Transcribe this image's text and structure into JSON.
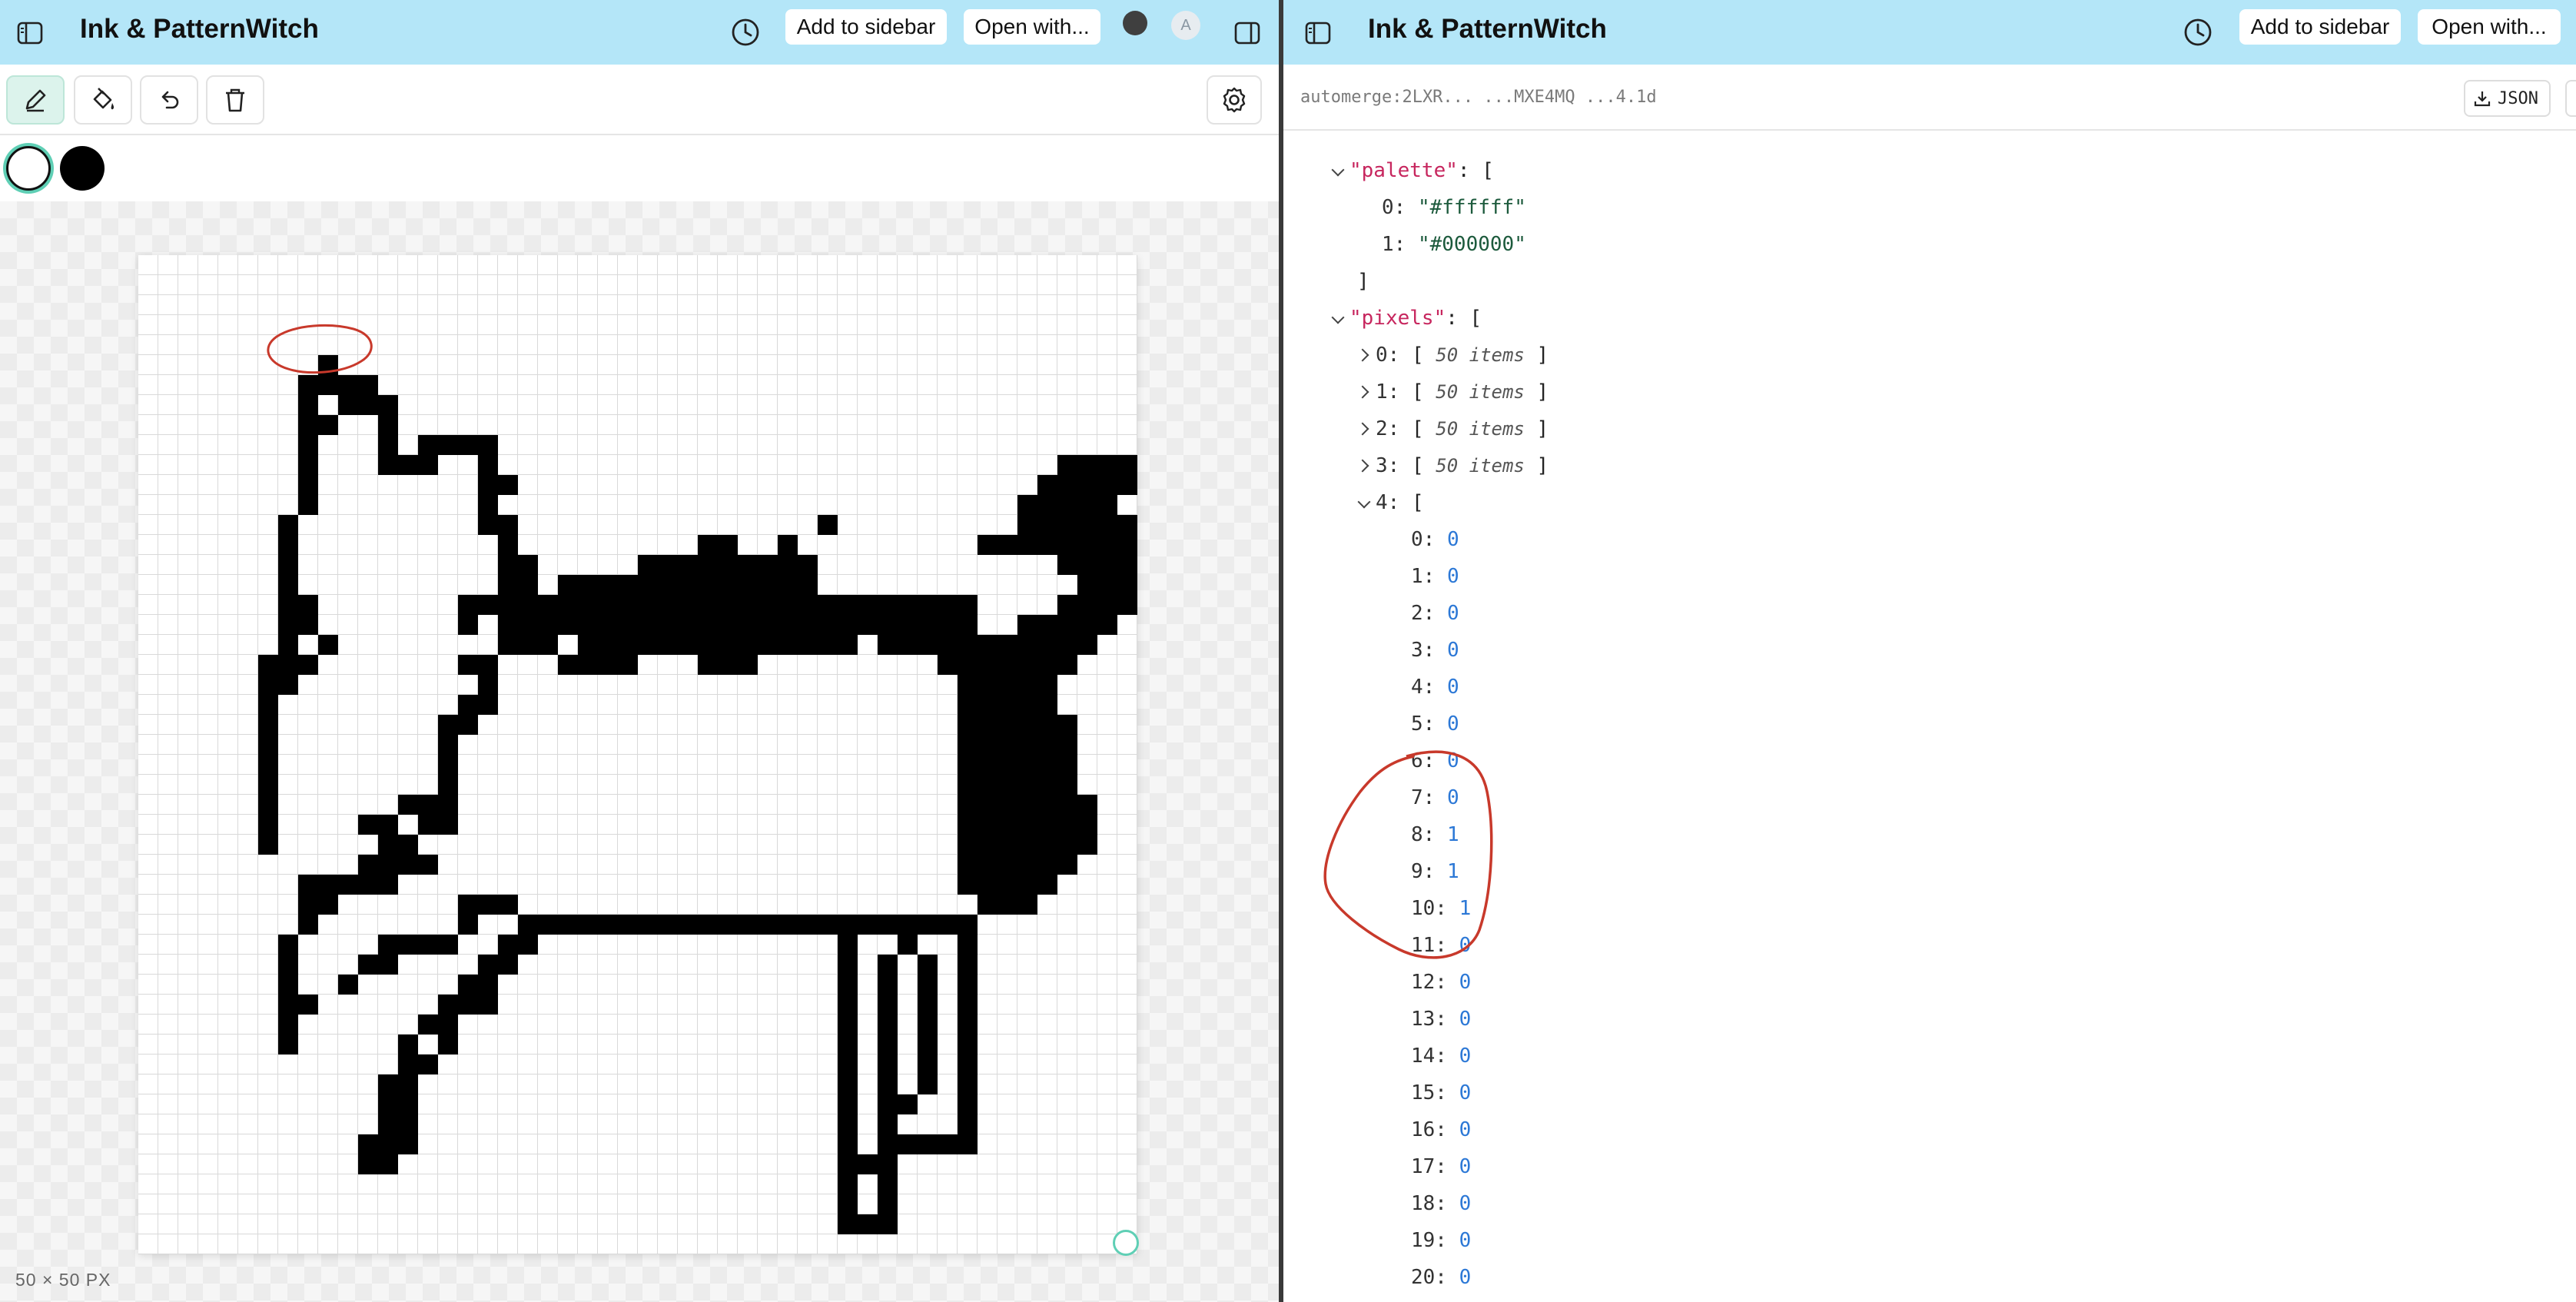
{
  "left": {
    "app_title": "Ink & PatternWitch",
    "add_to_sidebar": "Add to sidebar",
    "open_with": "Open with...",
    "avatar_letter": "A",
    "canvas_size_label": "50 × 50 PX",
    "palette_swatches": [
      "#ffffff",
      "#000000"
    ],
    "pixel_rows": [
      "00000000000000000000000000000000000000000000000000",
      "00000000000000000000000000000000000000000000000000",
      "00000000000000000000000000000000000000000000000000",
      "00000000000000000000000000000000000000000000000000",
      "00000000000000000000000000000000000000000000000000",
      "00000000010000000000000000000000000000000000000000",
      "00000000111100000000000000000000000000000000000000",
      "00000000101110000000000000000000000000000000000000",
      "00000000110010000000000000000000000000000000000000",
      "00000000100010111100000000000000000000000000000000",
      "00000000100011100100000000000000000000000000001111",
      "00000000100000000110000000000000000000000000011111",
      "00000000100000000100000000000000000000000000111110",
      "00000001000000000110000000000000001000000000111111",
      "00000001000000000010000000001100100000000011111111",
      "00000001000000000011000001111111110000000000001111",
      "00000001000000000011011111111111110000000000000111",
      "00000001100000001111111111111111111111111100001111",
      "00000001100000001011111111111111111111111100111110",
      "00000001010000000011101111111111111101111111111100",
      "00000011100000001100011110001110000000001111111000",
      "00000011000000000100000000000000000000000111110000",
      "00000010000000001100000000000000000000000111110000",
      "00000010000000011000000000000000000000000111111000",
      "00000010000000010000000000000000000000000111111000",
      "00000010000000010000000000000000000000000111111000",
      "00000010000000010000000000000000000000000111111000",
      "00000010000001110000000000000000000000000111111100",
      "00000010000110110000000000000000000000000111111100",
      "00000010000011000000000000000000000000000111111100",
      "00000000000111100000000000000000000000000111111000",
      "00000000111110000000000000000000000000000111110000",
      "00000000110000001110000000000000000000000011100000",
      "00000000100000001001111111111111111111111100000000",
      "00000001000011110011000000000000000100100100000000",
      "00000001000110000110000000000000000101010100000000",
      "00000001001000001100000000000000000101010100000000",
      "00000001100000011100000000000000000101010100000000",
      "00000001000000110000000000000000000101010100000000",
      "00000001000001010000000000000000000101010100000000",
      "00000000000001100000000000000000000101010100000000",
      "00000000000011000000000000000000000101010100000000",
      "00000000000011000000000000000000000101100100000000",
      "00000000000011000000000000000000000101000100000000",
      "00000000000111000000000000000000000101111100000000",
      "00000000000110000000000000000000000111000000000000",
      "00000000000000000000000000000000000101000000000000",
      "00000000000000000000000000000000000101000000000000",
      "00000000000000000000000000000000000111000000000000",
      "00000000000000000000000000000000000000000000000000"
    ]
  },
  "right": {
    "app_title": "Ink & PatternWitch",
    "add_to_sidebar": "Add to sidebar",
    "open_with": "Open with...",
    "doc_url": "automerge:2LXR...  ...MXE4MQ  ...4.1d",
    "json_button": "JSON",
    "tree": {
      "palette_key": "\"palette\"",
      "palette_items": [
        {
          "index": "0:",
          "value": "\"#ffffff\""
        },
        {
          "index": "1:",
          "value": "\"#000000\""
        }
      ],
      "pixels_key": "\"pixels\"",
      "collapsed_rows": [
        {
          "index": "0:",
          "summary": "50 items"
        },
        {
          "index": "1:",
          "summary": "50 items"
        },
        {
          "index": "2:",
          "summary": "50 items"
        },
        {
          "index": "3:",
          "summary": "50 items"
        }
      ],
      "expanded_row_index": "4:",
      "expanded_values": [
        {
          "index": "0:",
          "value": "0"
        },
        {
          "index": "1:",
          "value": "0"
        },
        {
          "index": "2:",
          "value": "0"
        },
        {
          "index": "3:",
          "value": "0"
        },
        {
          "index": "4:",
          "value": "0"
        },
        {
          "index": "5:",
          "value": "0"
        },
        {
          "index": "6:",
          "value": "0"
        },
        {
          "index": "7:",
          "value": "0"
        },
        {
          "index": "8:",
          "value": "1"
        },
        {
          "index": "9:",
          "value": "1"
        },
        {
          "index": "10:",
          "value": "1"
        },
        {
          "index": "11:",
          "value": "0"
        },
        {
          "index": "12:",
          "value": "0"
        },
        {
          "index": "13:",
          "value": "0"
        },
        {
          "index": "14:",
          "value": "0"
        },
        {
          "index": "15:",
          "value": "0"
        },
        {
          "index": "16:",
          "value": "0"
        },
        {
          "index": "17:",
          "value": "0"
        },
        {
          "index": "18:",
          "value": "0"
        },
        {
          "index": "19:",
          "value": "0"
        },
        {
          "index": "20:",
          "value": "0"
        }
      ]
    }
  },
  "colors": {
    "topbar": "#b4e6f8",
    "annotation": "#c8392b",
    "accent": "#5fcfb5"
  }
}
